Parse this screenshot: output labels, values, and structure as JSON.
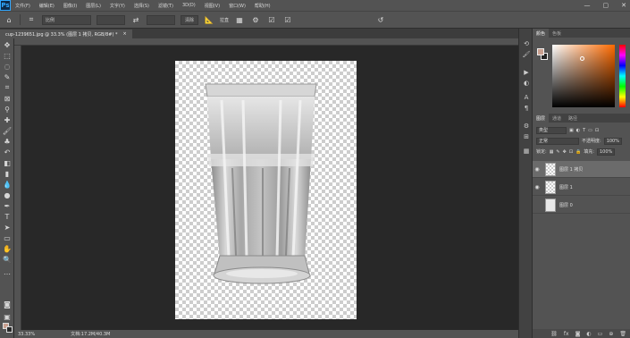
{
  "menu": [
    "文件(F)",
    "编辑(E)",
    "图像(I)",
    "图层(L)",
    "文字(Y)",
    "选择(S)",
    "滤镜(T)",
    "3D(D)",
    "视图(V)",
    "窗口(W)",
    "帮助(H)"
  ],
  "window_controls": {
    "minimize": "—",
    "maximize": "▢",
    "close": "✕"
  },
  "options": {
    "ratio_label": "比例",
    "clear_label": "清除",
    "straighten_label": "拉直"
  },
  "document_tab": {
    "title": "cup-1239651.jpg @ 33.3% (图层 1 拷贝, RGB/8#) *",
    "close": "×"
  },
  "status": {
    "zoom": "33.33%",
    "doc_size": "文档:17.2M/40.3M"
  },
  "color_panel": {
    "tabs": [
      "颜色",
      "色板"
    ]
  },
  "layers_panel": {
    "tabs": [
      "图层",
      "通道",
      "路径"
    ],
    "filter_label": "类型",
    "blend_mode": "正常",
    "opacity_label": "不透明度:",
    "opacity_value": "100%",
    "lock_label": "锁定:",
    "fill_label": "填充:",
    "fill_value": "100%",
    "layers": [
      {
        "name": "图层 1 拷贝",
        "visible": true,
        "selected": true
      },
      {
        "name": "图层 1",
        "visible": true,
        "selected": false
      },
      {
        "name": "图层 0",
        "visible": false,
        "selected": false
      }
    ]
  },
  "colors": {
    "foreground": "#c9a090",
    "background": "#222222",
    "accent": "#31a8ff"
  }
}
